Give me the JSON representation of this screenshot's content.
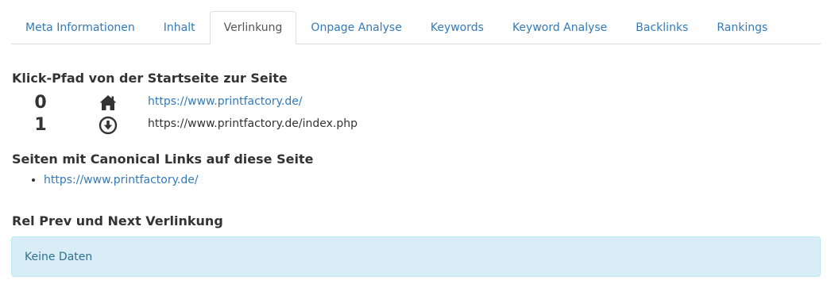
{
  "tabs": [
    {
      "label": "Meta Informationen",
      "active": false
    },
    {
      "label": "Inhalt",
      "active": false
    },
    {
      "label": "Verlinkung",
      "active": true
    },
    {
      "label": "Onpage Analyse",
      "active": false
    },
    {
      "label": "Keywords",
      "active": false
    },
    {
      "label": "Keyword Analyse",
      "active": false
    },
    {
      "label": "Backlinks",
      "active": false
    },
    {
      "label": "Rankings",
      "active": false
    }
  ],
  "click_path": {
    "heading": "Klick-Pfad von der Startseite zur Seite",
    "rows": [
      {
        "depth": "0",
        "icon": "home-icon",
        "url": "https://www.printfactory.de/",
        "is_link": true
      },
      {
        "depth": "1",
        "icon": "circle-arrow-down-icon",
        "url": "https://www.printfactory.de/index.php",
        "is_link": false
      }
    ]
  },
  "canonical": {
    "heading": "Seiten mit Canonical Links auf diese Seite",
    "items": [
      "https://www.printfactory.de/"
    ]
  },
  "rel_prev_next": {
    "heading": "Rel Prev und Next Verlinkung",
    "message": "Keine Daten"
  },
  "colors": {
    "link": "#337ab7",
    "info_bg": "#d9edf7",
    "info_border": "#bce8f1",
    "info_text": "#31708f"
  }
}
